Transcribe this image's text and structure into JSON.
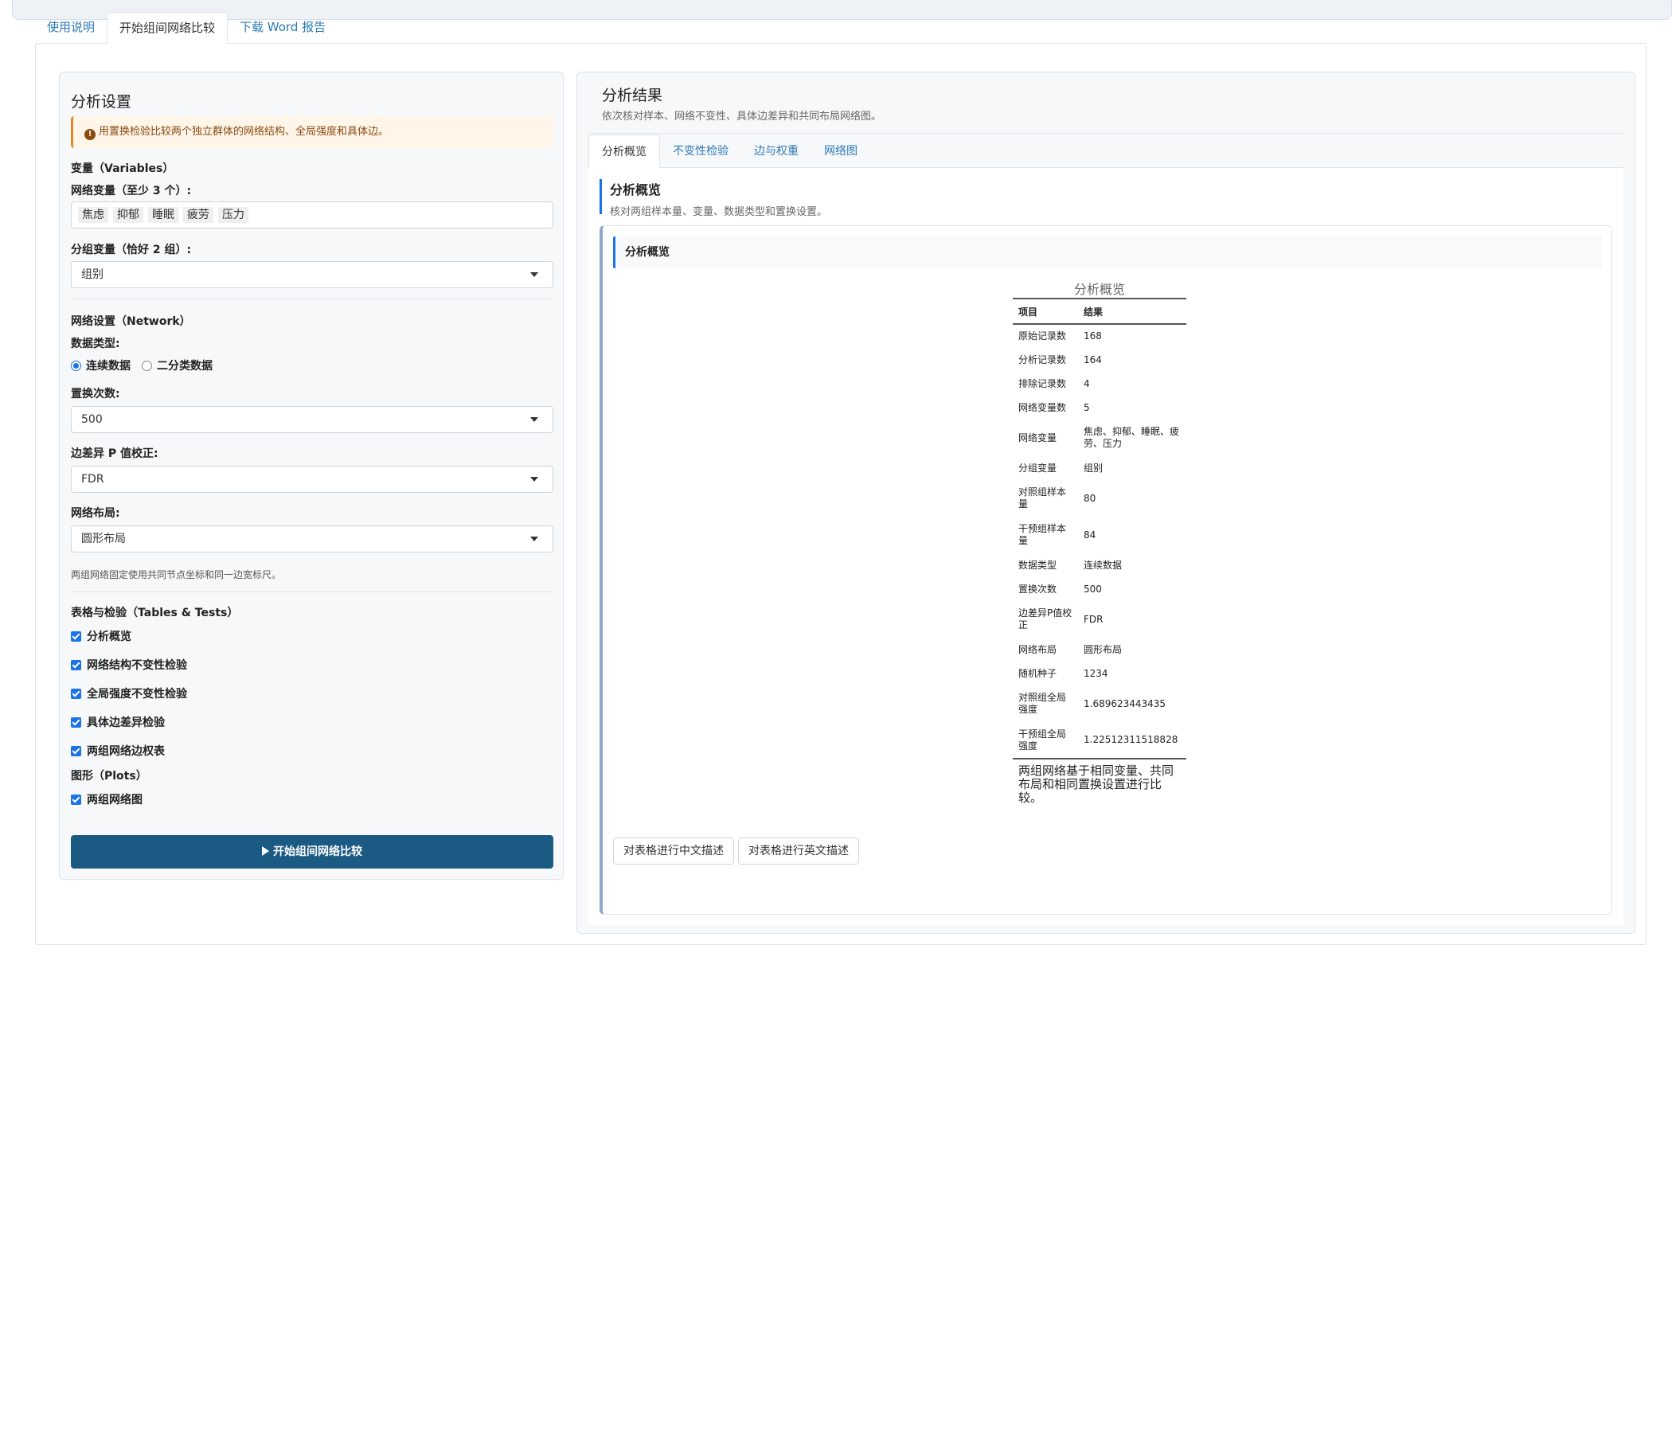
{
  "main_tabs": [
    {
      "label": "使用说明"
    },
    {
      "label": "开始组间网络比较"
    },
    {
      "label": "下载 Word 报告"
    }
  ],
  "settings": {
    "title": "分析设置",
    "alert": "用置换检验比较两个独立群体的网络结构、全局强度和具体边。",
    "variables_head": "变量（Variables）",
    "network_vars_label": "网络变量（至少 3 个）:",
    "network_vars": [
      "焦虑",
      "抑郁",
      "睡眠",
      "疲劳",
      "压力"
    ],
    "group_var_label": "分组变量（恰好 2 组）:",
    "group_var": "组别",
    "network_head": "网络设置（Network）",
    "data_type_label": "数据类型:",
    "data_type_options": [
      "连续数据",
      "二分类数据"
    ],
    "permutations_label": "置换次数:",
    "permutations": "500",
    "pcorrect_label": "边差异 P 值校正:",
    "pcorrect": "FDR",
    "layout_label": "网络布局:",
    "layout": "圆形布局",
    "layout_help": "两组网络固定使用共同节点坐标和同一边宽标尺。",
    "tables_head": "表格与检验（Tables & Tests）",
    "tables": [
      "分析概览",
      "网络结构不变性检验",
      "全局强度不变性检验",
      "具体边差异检验",
      "两组网络边权表"
    ],
    "plots_head": "图形（Plots）",
    "plots": [
      "两组网络图"
    ],
    "run_button": "开始组间网络比较"
  },
  "results": {
    "title": "分析结果",
    "subtitle": "依次核对样本、网络不变性、具体边差异和共同布局网络图。",
    "tabs": [
      {
        "label": "分析概览"
      },
      {
        "label": "不变性检验"
      },
      {
        "label": "边与权重"
      },
      {
        "label": "网络图"
      }
    ],
    "overview_title": "分析概览",
    "overview_sub": "核对两组样本量、变量、数据类型和置换设置。",
    "card_title": "分析概览",
    "table_caption": "分析概览",
    "table_headers": [
      "项目",
      "结果"
    ],
    "table_rows": [
      [
        "原始记录数",
        "168"
      ],
      [
        "分析记录数",
        "164"
      ],
      [
        "排除记录数",
        "4"
      ],
      [
        "网络变量数",
        "5"
      ],
      [
        "网络变量",
        "焦虑、抑郁、睡眠、疲劳、压力"
      ],
      [
        "分组变量",
        "组别"
      ],
      [
        "对照组样本量",
        "80"
      ],
      [
        "干预组样本量",
        "84"
      ],
      [
        "数据类型",
        "连续数据"
      ],
      [
        "置换次数",
        "500"
      ],
      [
        "边差异P值校正",
        "FDR"
      ],
      [
        "网络布局",
        "圆形布局"
      ],
      [
        "随机种子",
        "1234"
      ],
      [
        "对照组全局强度",
        "1.689623443435"
      ],
      [
        "干预组全局强度",
        "1.22512311518828"
      ]
    ],
    "table_note": "两组网络基于相同变量、共同布局和相同置换设置进行比较。",
    "btn_cn": "对表格进行中文描述",
    "btn_en": "对表格进行英文描述"
  }
}
